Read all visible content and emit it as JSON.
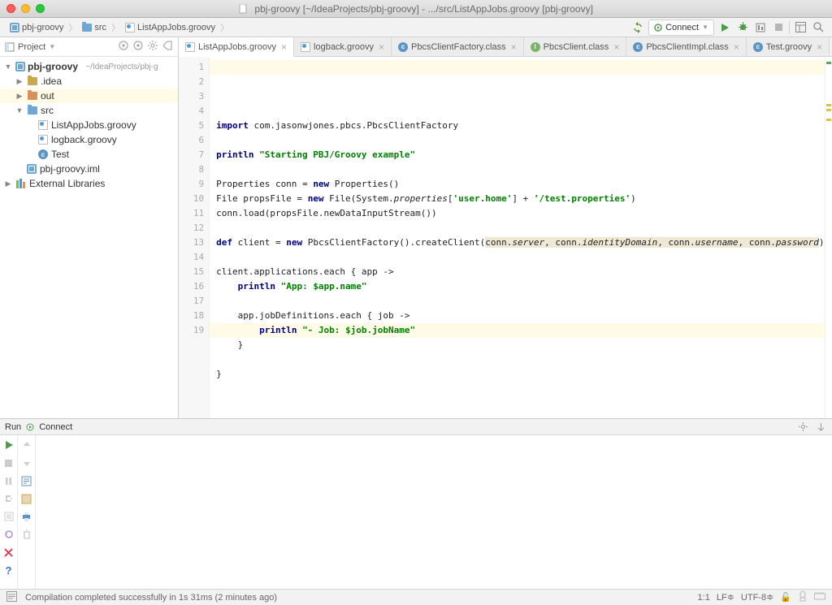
{
  "title": "pbj-groovy [~/IdeaProjects/pbj-groovy] - .../src/ListAppJobs.groovy [pbj-groovy]",
  "breadcrumbs": [
    "pbj-groovy",
    "src",
    "ListAppJobs.groovy"
  ],
  "runconfig": {
    "label": "Connect"
  },
  "sidebar": {
    "title": "Project",
    "root": {
      "name": "pbj-groovy",
      "path": "~/IdeaProjects/pbj-g"
    },
    "nodes": {
      "idea": ".idea",
      "out": "out",
      "src": "src",
      "listapp": "ListAppJobs.groovy",
      "logback": "logback.groovy",
      "test": "Test",
      "iml": "pbj-groovy.iml",
      "ext": "External Libraries"
    }
  },
  "tabs": [
    {
      "label": "ListAppJobs.groovy",
      "icon": "g",
      "active": true
    },
    {
      "label": "logback.groovy",
      "icon": "g"
    },
    {
      "label": "PbcsClientFactory.class",
      "icon": "c"
    },
    {
      "label": "PbcsClient.class",
      "icon": "i"
    },
    {
      "label": "PbcsClientImpl.class",
      "icon": "c"
    },
    {
      "label": "Test.groovy",
      "icon": "c"
    }
  ],
  "code": {
    "lines": [
      "import com.jasonwjones.pbcs.PbcsClientFactory",
      "",
      "println \"Starting PBJ/Groovy example\"",
      "",
      "Properties conn = new Properties()",
      "File propsFile = new File(System.properties['user.home'] + '/test.properties')",
      "conn.load(propsFile.newDataInputStream())",
      "",
      "def client = new PbcsClientFactory().createClient(conn.server, conn.identityDomain, conn.username, conn.password)",
      "",
      "client.applications.each { app ->",
      "    println \"App: $app.name\"",
      "",
      "    app.jobDefinitions.each { job ->",
      "        println \"- Job: $job.jobName\"",
      "    }",
      "",
      "}",
      ""
    ]
  },
  "runpanel": {
    "title": "Run",
    "config": "Connect"
  },
  "status": {
    "msg": "Compilation completed successfully in 1s 31ms (2 minutes ago)",
    "pos": "1:1",
    "lf": "LF",
    "enc": "UTF-8"
  },
  "chart_data": null
}
